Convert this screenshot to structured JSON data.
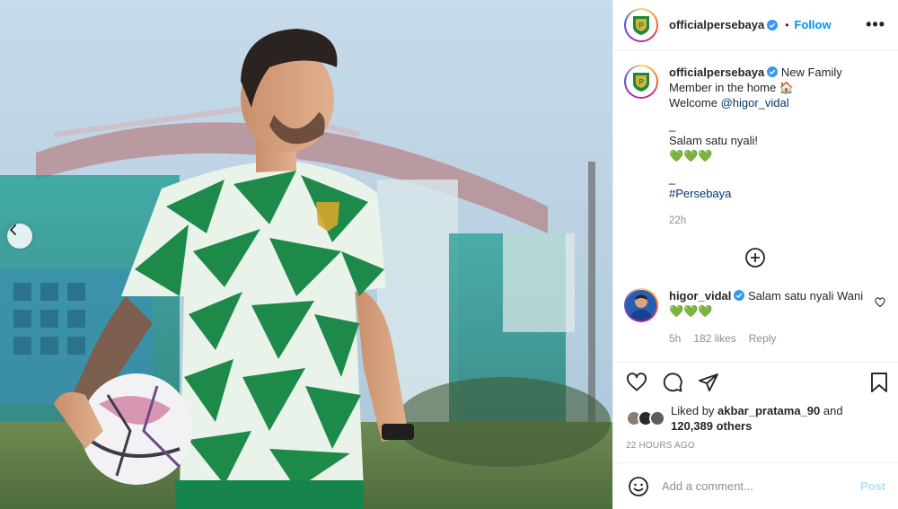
{
  "post": {
    "account": {
      "username": "officialpersebaya",
      "follow_label": "Follow",
      "more_label": "•••",
      "dot": "•"
    },
    "caption": {
      "username": "officialpersebaya",
      "line1": "New Family Member in the home 🏠",
      "welcome": "Welcome ",
      "mention": "@higor_vidal",
      "sep1": "_",
      "line2": "Salam satu nyali!",
      "emoji_line": "💚💚💚",
      "sep2": "_",
      "hashtag": "#Persebaya",
      "age": "22h"
    },
    "comment": {
      "username": "higor_vidal",
      "text": "Salam satu nyali Wani",
      "emoji_line": "💚💚💚",
      "age": "5h",
      "likes": "182 likes",
      "reply_label": "Reply"
    },
    "liked_by": {
      "prefix": "Liked by ",
      "user": "akbar_pratama_90",
      "mid": " and",
      "count": "120,389 others"
    },
    "timestamp": "22 HOURS AGO",
    "add_comment": {
      "placeholder": "Add a comment...",
      "post_label": "Post"
    }
  },
  "icons": {
    "verified": "verified-badge-icon",
    "more": "more-options-icon",
    "load_more": "plus-circle-icon",
    "heart": "heart-icon",
    "comment": "comment-icon",
    "share": "share-icon",
    "save": "bookmark-icon",
    "emoji": "emoji-icon",
    "carousel_prev": "chevron-left-icon"
  },
  "colors": {
    "accent": "#0095f6",
    "link": "#00376b",
    "muted": "#8e8e8e",
    "post_disabled": "#b2dffc",
    "jersey_green": "#1e8a4a",
    "verified": "#3897f0"
  }
}
